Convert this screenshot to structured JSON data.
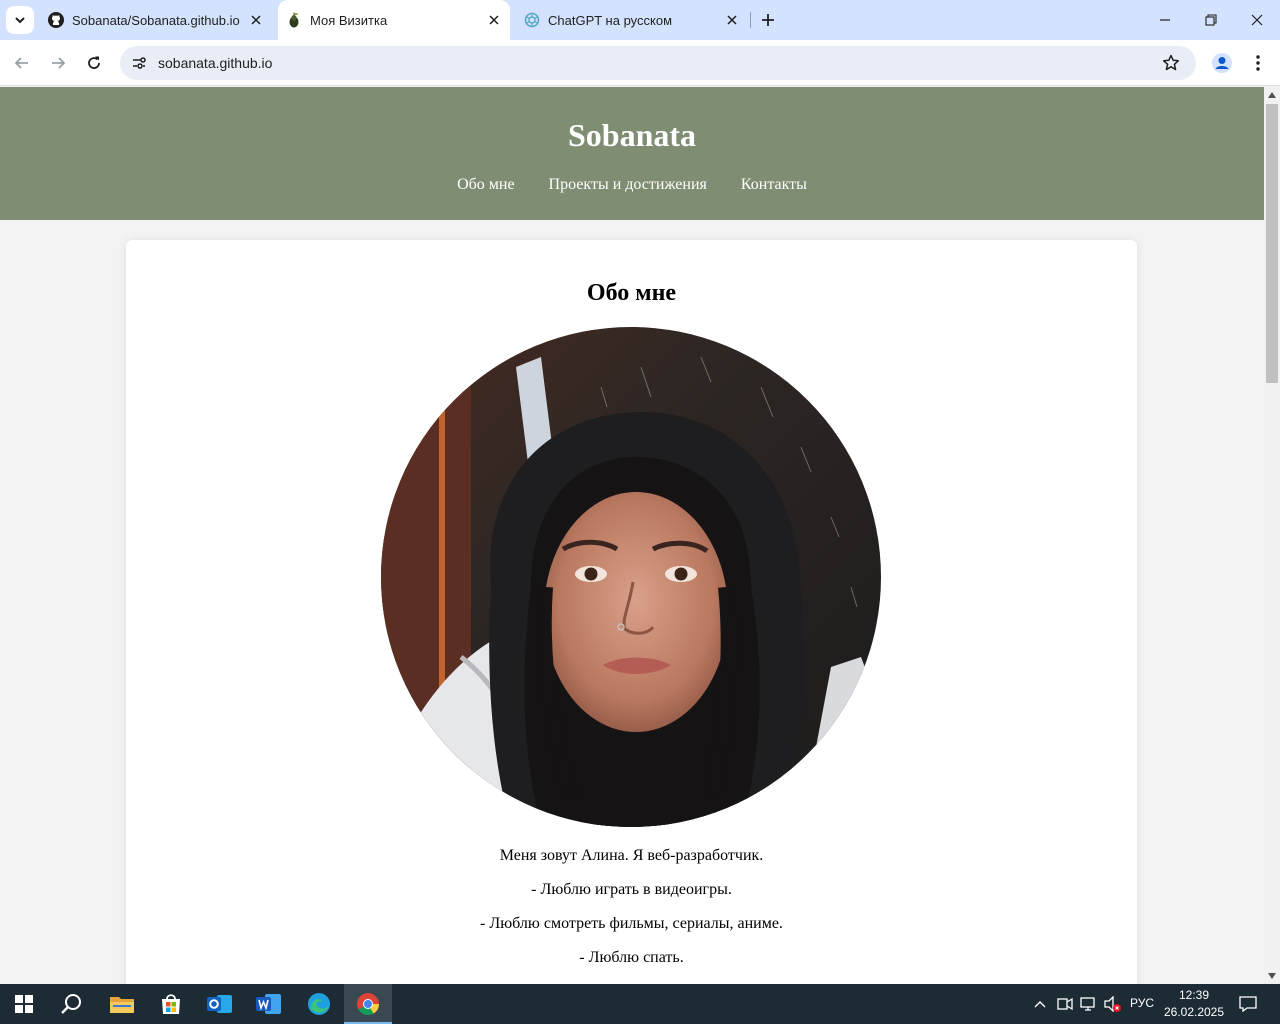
{
  "browser": {
    "tabs": [
      {
        "title": "Sobanata/Sobanata.github.io",
        "favicon": "github-icon",
        "active": false
      },
      {
        "title": "Моя Визитка",
        "favicon": "pear-icon",
        "active": true
      },
      {
        "title": "ChatGPT на русском",
        "favicon": "chatgpt-icon",
        "active": false
      }
    ],
    "url": "sobanata.github.io"
  },
  "site": {
    "title": "Sobanata",
    "nav": [
      "Обо мне",
      "Проекты и достижения",
      "Контакты"
    ],
    "header_color": "#7f8d73"
  },
  "about": {
    "heading": "Обо мне",
    "photo_alt": "photo-of-girl-in-hood",
    "lines": [
      "Меня зовут Алина. Я веб-разработчик.",
      "- Люблю играть в видеоигры.",
      "- Люблю смотреть фильмы, сериалы, аниме.",
      "- Люблю спать."
    ]
  },
  "taskbar": {
    "apps": [
      "start-icon",
      "search-icon",
      "file-explorer-icon",
      "store-icon",
      "outlook-icon",
      "word-icon",
      "edge-icon",
      "chrome-icon"
    ],
    "active_app": "chrome-icon",
    "language": "РУС",
    "time": "12:39",
    "date": "26.02.2025"
  }
}
